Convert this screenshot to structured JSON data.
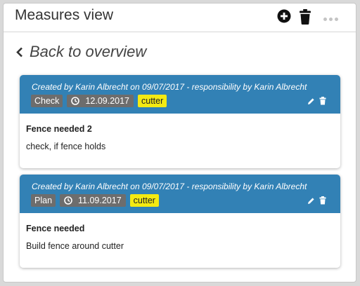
{
  "header": {
    "title": "Measures view",
    "add_icon": "plus-circle-icon",
    "delete_icon": "trash-icon",
    "more_icon": "more-horizontal-icon"
  },
  "back_link": {
    "label": "Back to overview",
    "icon": "chevron-left-icon"
  },
  "measures": [
    {
      "meta": "Created by Karin Albrecht on 09/07/2017 - responsibility by Karin Albrecht",
      "type": "Check",
      "date": "12.09.2017",
      "tag": "cutter",
      "title": "Fence needed 2",
      "description": "check, if fence holds"
    },
    {
      "meta": "Created by Karin Albrecht on 09/07/2017 - responsibility by Karin Albrecht",
      "type": "Plan",
      "date": "11.09.2017",
      "tag": "cutter",
      "title": "Fence needed",
      "description": "Build fence around cutter"
    }
  ],
  "colors": {
    "card_header": "#3281b5",
    "badge_gray": "#6d6d6d",
    "tag_yellow": "#f4ea12"
  }
}
